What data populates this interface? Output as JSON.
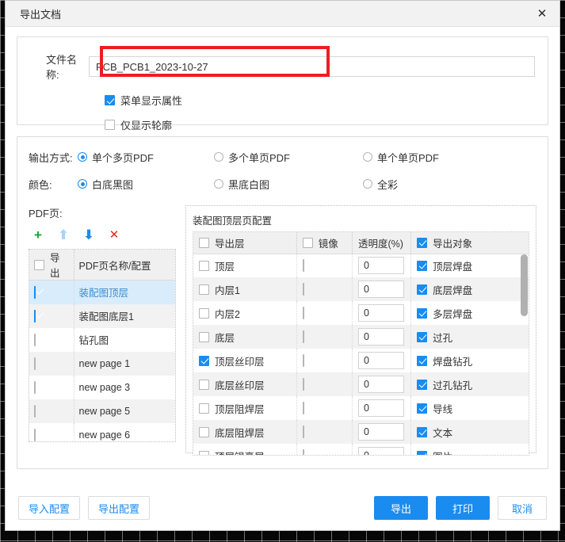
{
  "dialog": {
    "title": "导出文档",
    "close_icon": "close-icon"
  },
  "file_section": {
    "filename_label": "文件名称:",
    "filename_value": "PCB_PCB1_2023-10-27",
    "filename_placeholder": "",
    "checkboxes": [
      {
        "label": "菜单显示属性",
        "checked": true
      },
      {
        "label": "仅显示轮廓",
        "checked": false
      }
    ],
    "highlight_color": "#ee1c25"
  },
  "output_section": {
    "mode_label": "输出方式:",
    "mode_options": [
      {
        "label": "单个多页PDF",
        "selected": true
      },
      {
        "label": "多个单页PDF",
        "selected": false
      },
      {
        "label": "单个单页PDF",
        "selected": false
      }
    ],
    "color_label": "颜色:",
    "color_options": [
      {
        "label": "白底黑图",
        "selected": true
      },
      {
        "label": "黑底白图",
        "selected": false
      },
      {
        "label": "全彩",
        "selected": false
      }
    ]
  },
  "pdf_pages": {
    "section_label": "PDF页:",
    "toolbar": [
      {
        "name": "add-page-icon",
        "glyph": "+"
      },
      {
        "name": "move-up-icon",
        "glyph": "↑"
      },
      {
        "name": "move-down-icon",
        "glyph": "↓"
      },
      {
        "name": "delete-page-icon",
        "glyph": "✕"
      }
    ],
    "headers": {
      "export": "导出",
      "name": "PDF页名称/配置"
    },
    "header_checked": false,
    "rows": [
      {
        "name": "装配图顶层",
        "checked": true,
        "selected": true
      },
      {
        "name": "装配图底层1",
        "checked": true,
        "selected": false
      },
      {
        "name": "钻孔图",
        "checked": false,
        "selected": false
      },
      {
        "name": "new page 1",
        "checked": false,
        "selected": false
      },
      {
        "name": "new page 3",
        "checked": false,
        "selected": false
      },
      {
        "name": "new page 5",
        "checked": false,
        "selected": false
      },
      {
        "name": "new page 6",
        "checked": false,
        "selected": false
      }
    ]
  },
  "layer_config": {
    "title": "装配图顶层页配置",
    "headers": {
      "layer": "导出层",
      "layer_checked": false,
      "mirror": "镜像",
      "mirror_checked": false,
      "alpha": "透明度(%)",
      "object": "导出对象",
      "object_checked": true
    },
    "rows": [
      {
        "layer": "顶层",
        "layer_checked": false,
        "mirror_checked": false,
        "mirror_disabled": true,
        "alpha": "0",
        "object": "顶层焊盘",
        "object_checked": true
      },
      {
        "layer": "内层1",
        "layer_checked": false,
        "mirror_checked": false,
        "mirror_disabled": true,
        "alpha": "0",
        "object": "底层焊盘",
        "object_checked": true
      },
      {
        "layer": "内层2",
        "layer_checked": false,
        "mirror_checked": false,
        "mirror_disabled": true,
        "alpha": "0",
        "object": "多层焊盘",
        "object_checked": true
      },
      {
        "layer": "底层",
        "layer_checked": false,
        "mirror_checked": false,
        "mirror_disabled": true,
        "alpha": "0",
        "object": "过孔",
        "object_checked": true
      },
      {
        "layer": "顶层丝印层",
        "layer_checked": true,
        "mirror_checked": false,
        "mirror_disabled": false,
        "alpha": "0",
        "object": "焊盘钻孔",
        "object_checked": true
      },
      {
        "layer": "底层丝印层",
        "layer_checked": false,
        "mirror_checked": false,
        "mirror_disabled": true,
        "alpha": "0",
        "object": "过孔钻孔",
        "object_checked": true
      },
      {
        "layer": "顶层阻焊层",
        "layer_checked": false,
        "mirror_checked": false,
        "mirror_disabled": true,
        "alpha": "0",
        "object": "导线",
        "object_checked": true
      },
      {
        "layer": "底层阻焊层",
        "layer_checked": false,
        "mirror_checked": false,
        "mirror_disabled": true,
        "alpha": "0",
        "object": "文本",
        "object_checked": true
      },
      {
        "layer": "顶层锡膏层",
        "layer_checked": false,
        "mirror_checked": false,
        "mirror_disabled": true,
        "alpha": "0",
        "object": "图片",
        "object_checked": true
      }
    ]
  },
  "footer": {
    "import_config": "导入配置",
    "export_config": "导出配置",
    "export": "导出",
    "print": "打印",
    "cancel": "取消",
    "primary_color": "#1a8cf0"
  }
}
